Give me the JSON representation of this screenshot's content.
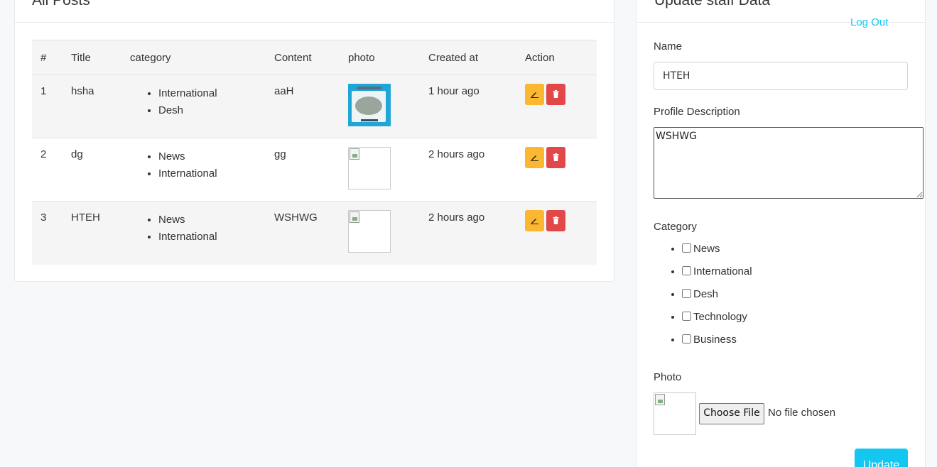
{
  "posts_card": {
    "title": "All Posts",
    "columns": [
      "#",
      "Title",
      "category",
      "Content",
      "photo",
      "Created at",
      "Action"
    ],
    "rows": [
      {
        "num": "1",
        "title": "hsha",
        "categories": [
          "International",
          "Desh"
        ],
        "content": "aaH",
        "created": "1 hour ago",
        "photo": "image"
      },
      {
        "num": "2",
        "title": "dg",
        "categories": [
          "News",
          "International"
        ],
        "content": "gg",
        "created": "2 hours ago",
        "photo": "broken"
      },
      {
        "num": "3",
        "title": "HTEH",
        "categories": [
          "News",
          "International"
        ],
        "content": "WSHWG",
        "created": "2 hours ago",
        "photo": "broken"
      }
    ]
  },
  "form_card": {
    "title": "Update staff Data",
    "logout_label": "Log Out",
    "name_label": "Name",
    "name_value": "HTEH",
    "description_label": "Profile Description",
    "description_value": "WSHWG",
    "category_label": "Category",
    "categories": [
      "News",
      "International",
      "Desh",
      "Technology",
      "Business"
    ],
    "photo_label": "Photo",
    "file_button_label": "Choose File",
    "file_status": "No file chosen",
    "update_label": "Update"
  },
  "colors": {
    "accent": "#14c7f0",
    "edit": "#fbb730",
    "delete": "#e34848"
  },
  "icons": {
    "edit": "pencil-icon",
    "delete": "trash-icon"
  }
}
